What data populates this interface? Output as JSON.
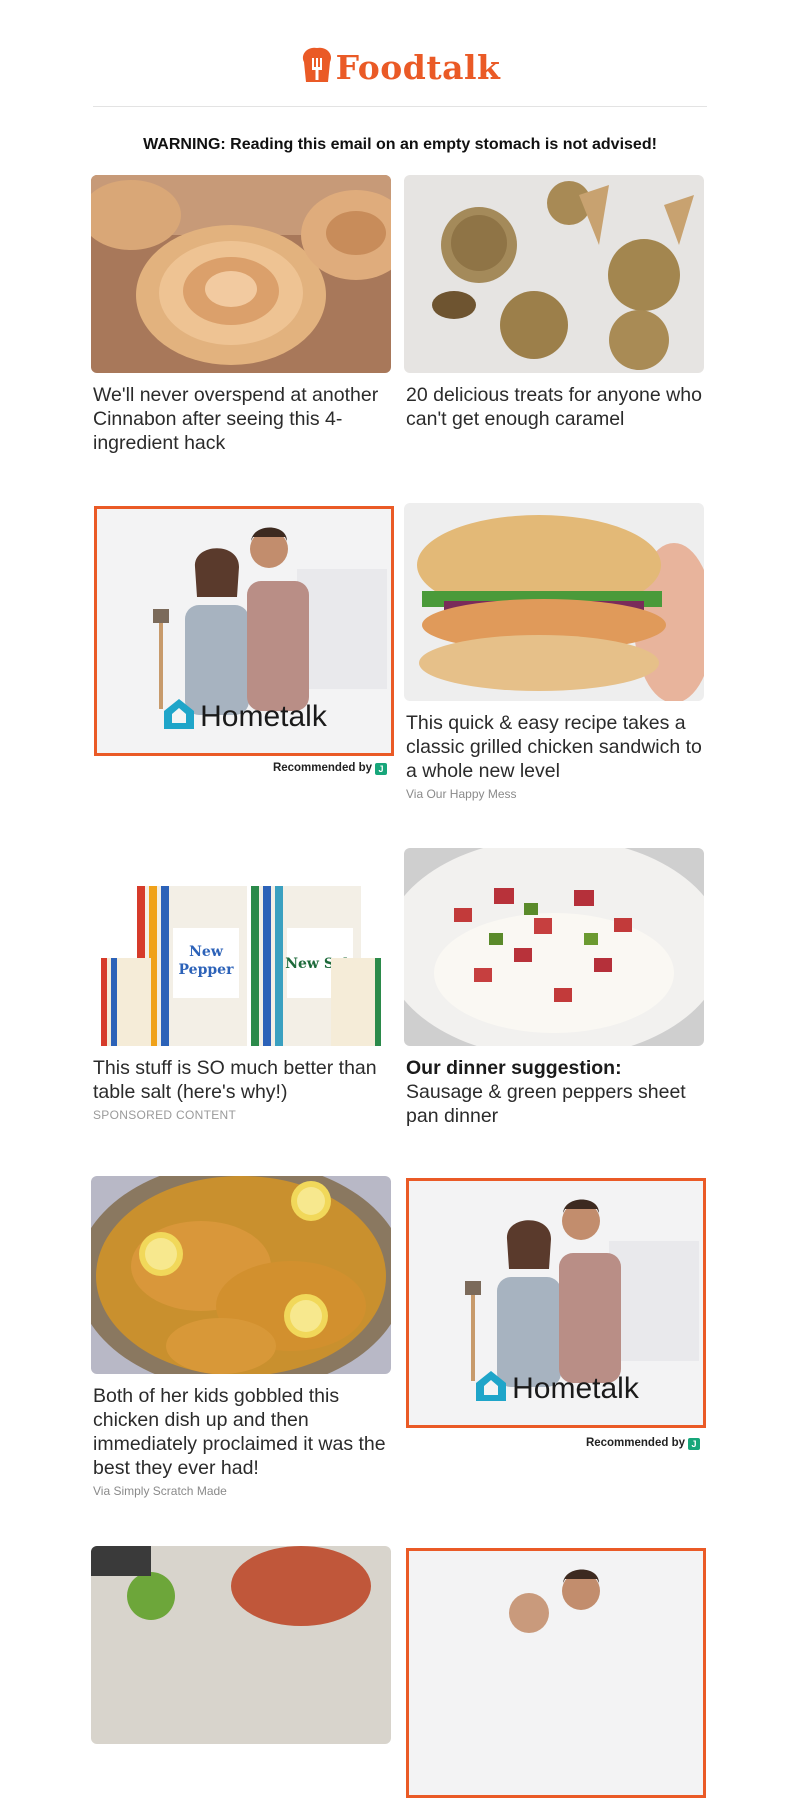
{
  "brand": {
    "name": "Foodtalk",
    "color": "#ea5a26",
    "icon": "chef-hat-fork-icon"
  },
  "warning": "WARNING: Reading this email on an empty stomach is not advised!",
  "cards": [
    {
      "title": "We'll never overspend at another Cinnabon after seeing this 4-ingredient hack",
      "image": "cinnamon-roll-pastry"
    },
    {
      "title": "20 delicious treats for anyone who can't get enough caramel",
      "image": "caramel-ice-cream-scoops"
    },
    {
      "title": "This quick & easy recipe takes a classic grilled chicken sandwich to a whole new level",
      "via": "Via Our Happy Mess",
      "image": "grilled-chicken-sandwich"
    },
    {
      "title": "This stuff is SO much better than table salt (here's why!)",
      "sponsored": "SPONSORED CONTENT",
      "image": "spicewell-salt-pepper-packs"
    },
    {
      "title_bold": "Our dinner suggestion:",
      "title": "Sausage & green peppers sheet pan dinner",
      "image": "sausage-rice-bowl"
    },
    {
      "title": "Both of her kids gobbled this chicken dish up and then immediately proclaimed it was the best they ever had!",
      "via": "Via Simply Scratch Made",
      "image": "lemon-chicken-skillet"
    }
  ],
  "ad": {
    "brand": "Hometalk",
    "recommended": "Recommended by",
    "border_color": "#ea5a26"
  }
}
